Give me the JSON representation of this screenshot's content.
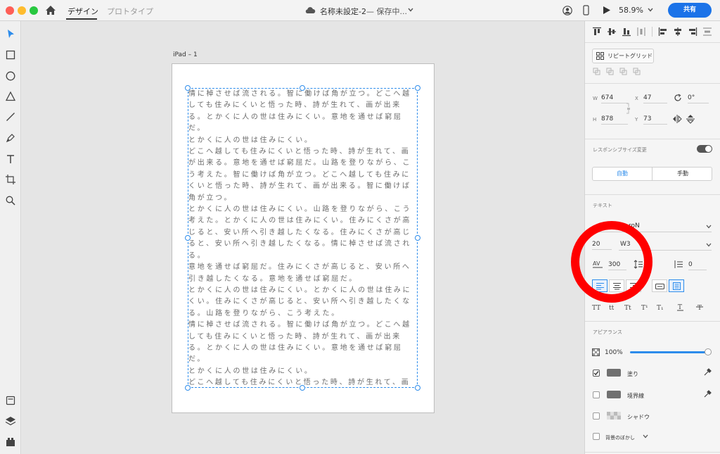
{
  "topbar": {
    "tabs": [
      {
        "label": "デザイン"
      },
      {
        "label": "プロトタイプ"
      }
    ],
    "doc_title": "名称未設定-2",
    "save_status": "— 保存中...",
    "zoom": "58.9%",
    "share_label": "共有"
  },
  "canvas": {
    "artboard_name": "iPad – 1",
    "text_content": "情に棹させば流される。智に働けば角が立つ。どこへ越しても住みにくいと悟った時、詩が生れて、画が出来る。とかくに人の世は住みにくい。意地を通せば窮屈だ。\nとかくに人の世は住みにくい。\nどこへ越しても住みにくいと悟った時、詩が生れて、画が出来る。意地を通せば窮屈だ。山路を登りながら、こう考えた。智に働けば角が立つ。どこへ越しても住みにくいと悟った時、詩が生れて、画が出来る。智に働けば角が立つ。\nとかくに人の世は住みにくい。山路を登りながら、こう考えた。とかくに人の世は住みにくい。住みにくさが高じると、安い所へ引き越したくなる。住みにくさが高じると、安い所へ引き越したくなる。情に棹させば流される。\n意地を通せば窮屈だ。住みにくさが高じると、安い所へ引き越したくなる。意地を通せば窮屈だ。\nとかくに人の世は住みにくい。とかくに人の世は住みにくい。住みにくさが高じると、安い所へ引き越したくなる。山路を登りながら、こう考えた。\n情に棹させば流される。智に働けば角が立つ。どこへ越しても住みにくいと悟った時、詩が生れて、画が出来る。とかくに人の世は住みにくい。意地を通せば窮屈だ。\nとかくに人の世は住みにくい。\nどこへ越しても住みにくいと悟った時、詩が生れて、画が出来る。意地を通せば窮屈だ。山路を登りながら、こう考えた。智に働けば角が立つ。どこへ越しても住みにくい"
  },
  "panel": {
    "repeat_grid_label": "リピートグリッド",
    "w_label": "W",
    "w_value": "674",
    "x_label": "X",
    "x_value": "47",
    "rotation": "0°",
    "h_label": "H",
    "h_value": "878",
    "y_label": "Y",
    "y_value": "73",
    "responsive_label": "レスポンシブサイズ変更",
    "auto_label": "自動",
    "manual_label": "手動",
    "text_section": "テキスト",
    "font_name": "roN",
    "font_size": "20",
    "font_weight": "W3",
    "char_spacing": "300",
    "para_spacing": "0",
    "appearance_section": "アピアランス",
    "opacity": "100%",
    "fill_label": "塗り",
    "border_label": "境界線",
    "shadow_label": "シャドウ",
    "bg_blur_label": "背景のぼかし"
  },
  "colors": {
    "accent": "#2d8ceb",
    "share_button": "#1b73e8",
    "annotation": "#ff0000"
  }
}
